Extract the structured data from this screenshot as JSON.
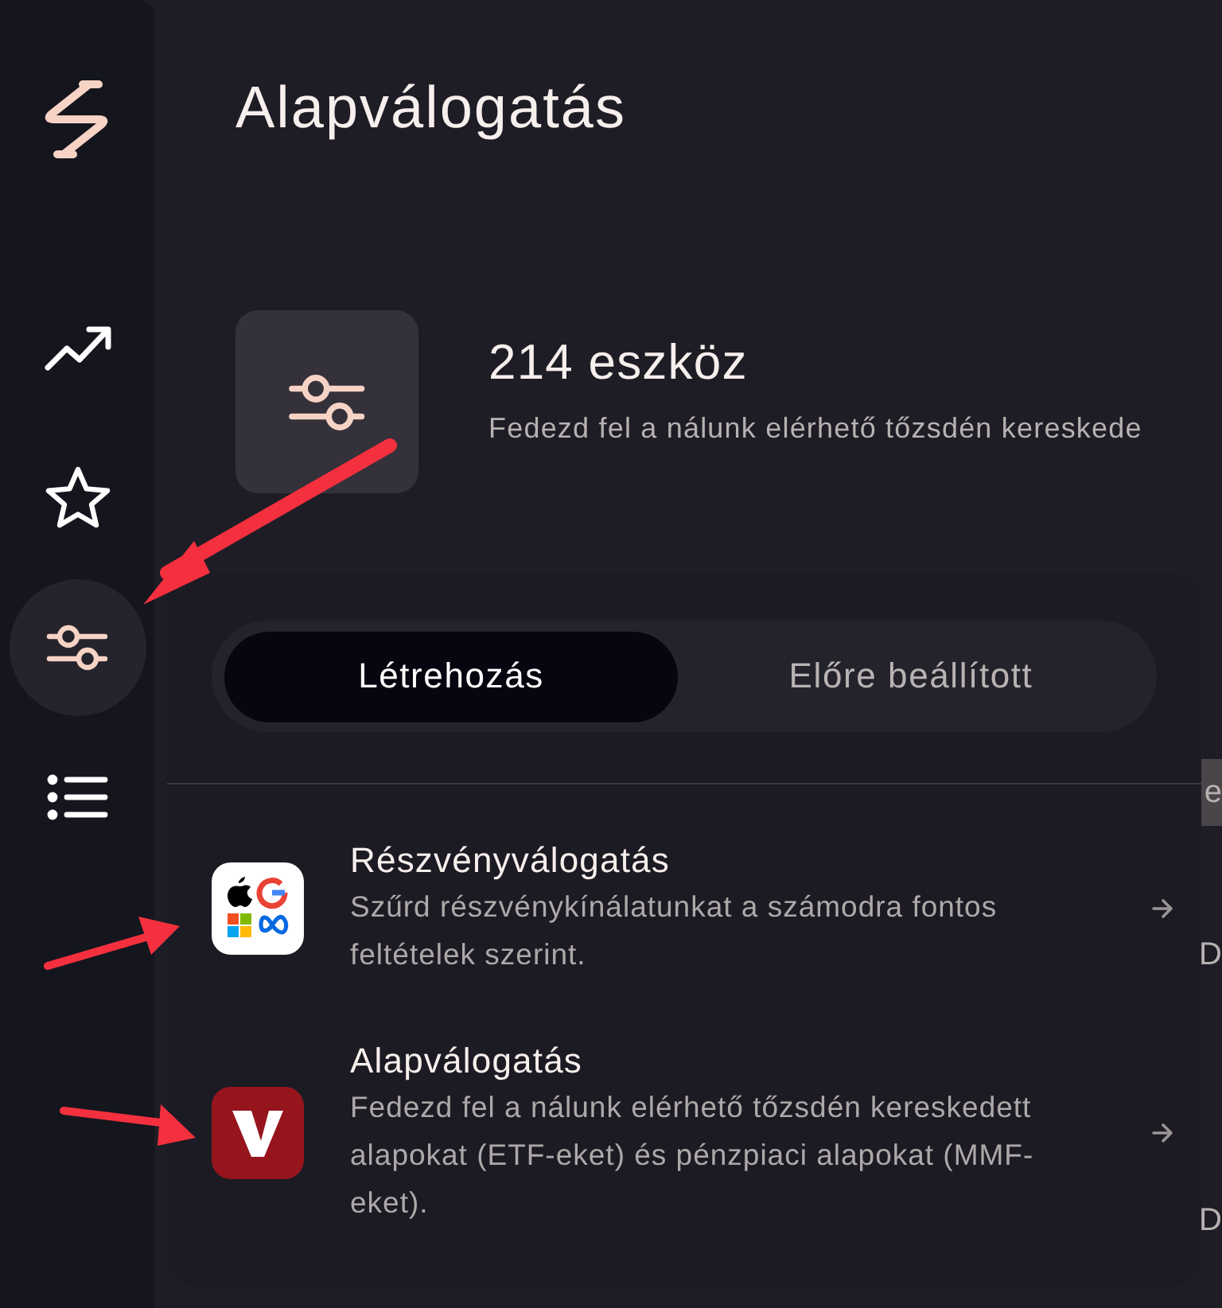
{
  "sidebar": {
    "items": [
      {
        "selected": false
      },
      {
        "selected": false
      },
      {
        "selected": true
      },
      {
        "selected": false
      }
    ]
  },
  "page": {
    "title": "Alapválogatás",
    "count": "214 eszköz",
    "subtitle": "Fedezd fel a nálunk elérhető tőzsdén kereskede"
  },
  "background_rows": [
    {
      "text": "e",
      "highlighted": true
    },
    {
      "text": "D",
      "highlighted": false
    },
    {
      "text": "D",
      "highlighted": false
    }
  ],
  "popup": {
    "tabs": [
      {
        "label": "Létrehozás",
        "selected": true
      },
      {
        "label": "Előre beállított",
        "selected": false
      }
    ],
    "items": [
      {
        "kind": "stocks",
        "title": "Részvényválogatás",
        "description": "Szűrd részvénykínálatunkat a számodra fontos feltételek szerint."
      },
      {
        "kind": "funds",
        "title": "Alapválogatás",
        "description": "Fedezd fel a nálunk elérhető tőzsdén kereskedett alapokat (ETF-eket) és pénzpiaci alapokat (MMF-eket)."
      }
    ]
  },
  "annotations": [
    {
      "kind": "arrow"
    },
    {
      "kind": "arrow"
    },
    {
      "kind": "arrow"
    }
  ]
}
